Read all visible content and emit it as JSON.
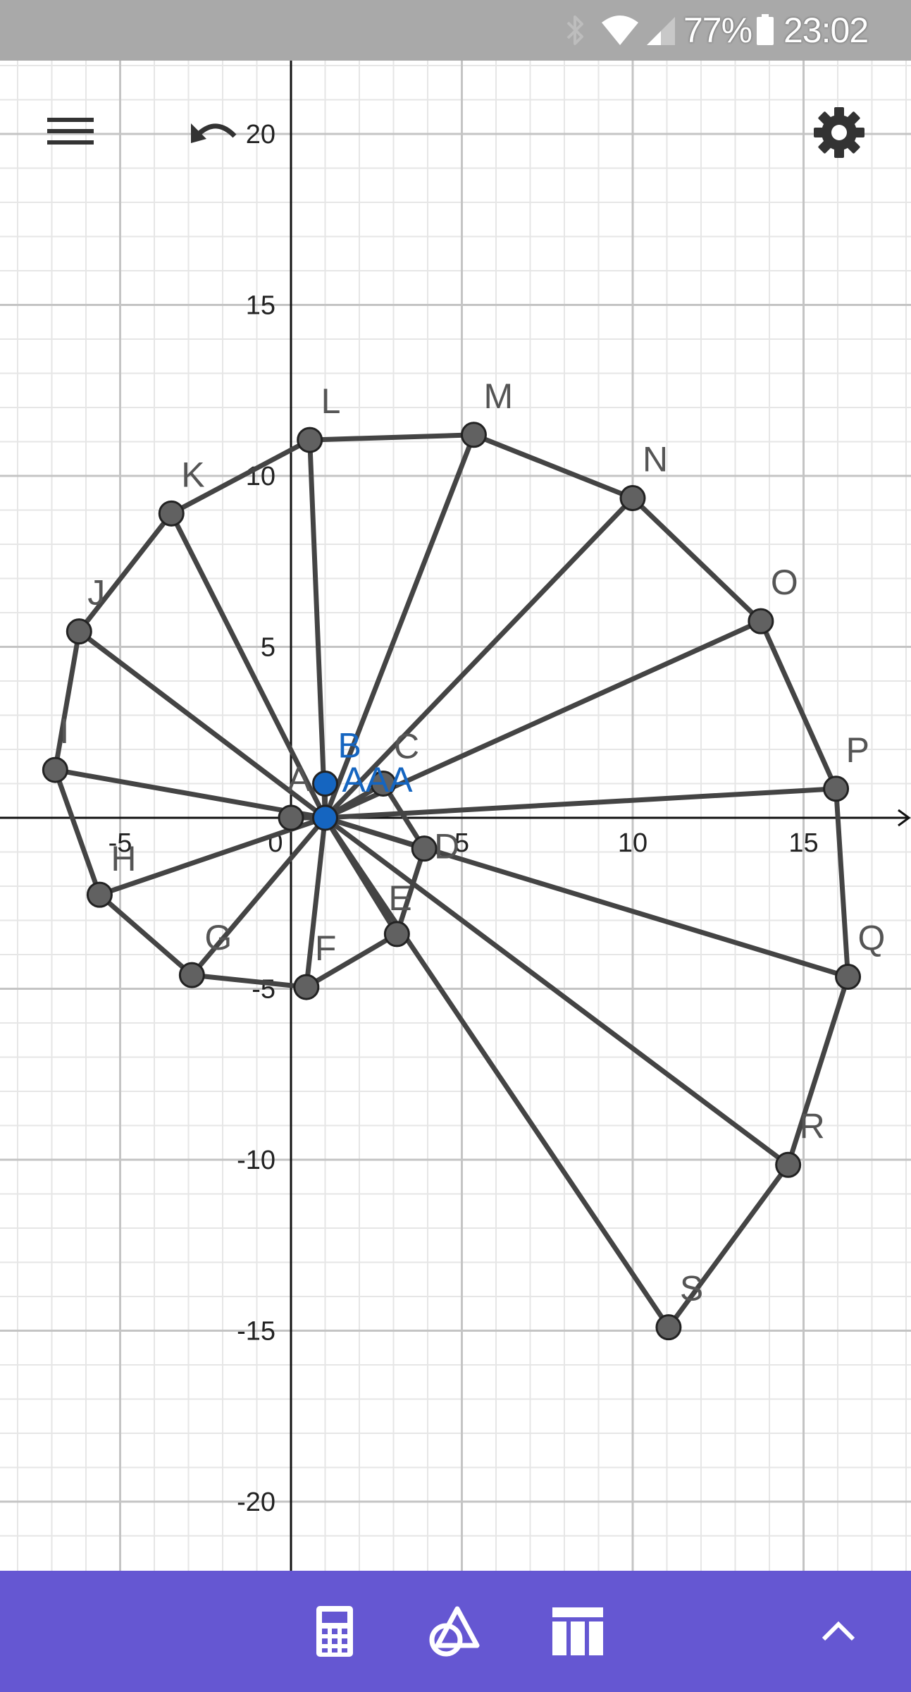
{
  "status_bar": {
    "battery_percent": "77%",
    "time": "23:02",
    "icons": [
      "bluetooth-icon",
      "wifi-icon",
      "signal-icon",
      "battery-icon"
    ]
  },
  "toolbar": {
    "menu_icon": "hamburger-menu-icon",
    "undo_icon": "undo-icon",
    "settings_icon": "gear-icon"
  },
  "graph": {
    "x_ticks": [
      "-5",
      "0",
      "5",
      "10",
      "15"
    ],
    "x_tick_values": [
      -5,
      0,
      5,
      10,
      15
    ],
    "y_ticks": [
      "20",
      "15",
      "10",
      "5",
      "-5",
      "-10",
      "-15",
      "-20"
    ],
    "y_tick_values": [
      20,
      15,
      10,
      5,
      -5,
      -10,
      -15,
      -20
    ],
    "x_range": [
      -8.5,
      18.2
    ],
    "y_range": [
      -21.9,
      23.9
    ],
    "grid": true,
    "points": [
      {
        "name": "A",
        "x": 0,
        "y": 0,
        "color": "gray"
      },
      {
        "name": "AA",
        "x": 1,
        "y": 0,
        "color": "blue"
      },
      {
        "name": "B",
        "x": 1,
        "y": 1,
        "color": "blue"
      },
      {
        "name": "C",
        "x": 2.7,
        "y": 1,
        "color": "gray"
      },
      {
        "name": "D",
        "x": 3.9,
        "y": -0.9,
        "color": "gray"
      },
      {
        "name": "E",
        "x": 3.1,
        "y": -3.4,
        "color": "gray"
      },
      {
        "name": "F",
        "x": 0.45,
        "y": -4.95,
        "color": "gray"
      },
      {
        "name": "G",
        "x": -2.9,
        "y": -4.6,
        "color": "gray"
      },
      {
        "name": "H",
        "x": -5.6,
        "y": -2.25,
        "color": "gray"
      },
      {
        "name": "I",
        "x": -6.9,
        "y": 1.4,
        "color": "gray"
      },
      {
        "name": "J",
        "x": -6.2,
        "y": 5.45,
        "color": "gray"
      },
      {
        "name": "K",
        "x": -3.5,
        "y": 8.9,
        "color": "gray"
      },
      {
        "name": "L",
        "x": 0.55,
        "y": 11.05,
        "color": "gray"
      },
      {
        "name": "M",
        "x": 5.35,
        "y": 11.2,
        "color": "gray"
      },
      {
        "name": "N",
        "x": 10.0,
        "y": 9.35,
        "color": "gray"
      },
      {
        "name": "O",
        "x": 13.75,
        "y": 5.75,
        "color": "gray"
      },
      {
        "name": "P",
        "x": 15.95,
        "y": 0.85,
        "color": "gray"
      },
      {
        "name": "Q",
        "x": 16.3,
        "y": -4.65,
        "color": "gray"
      },
      {
        "name": "R",
        "x": 14.55,
        "y": -10.15,
        "color": "gray"
      },
      {
        "name": "S",
        "x": 11.05,
        "y": -14.9,
        "color": "gray"
      }
    ],
    "spokes": [
      "A",
      "C",
      "D",
      "E",
      "F",
      "G",
      "H",
      "I",
      "J",
      "K",
      "L",
      "M",
      "N",
      "O",
      "P",
      "Q",
      "R",
      "S"
    ],
    "polygon": [
      "C",
      "D",
      "E",
      "F",
      "G",
      "H",
      "I",
      "J",
      "K",
      "L",
      "M",
      "N",
      "O",
      "P",
      "Q",
      "R",
      "S"
    ],
    "point_labels": [
      "A",
      "AAA",
      "B",
      "C",
      "D",
      "E",
      "F",
      "G",
      "H",
      "I",
      "J",
      "K",
      "L",
      "M",
      "N",
      "O",
      "P",
      "Q",
      "R",
      "S"
    ]
  },
  "bottom_bar": {
    "color": "#6557d2",
    "buttons": [
      "calculator-icon",
      "geometry-tools-icon",
      "table-icon",
      "chevron-up-icon"
    ]
  }
}
